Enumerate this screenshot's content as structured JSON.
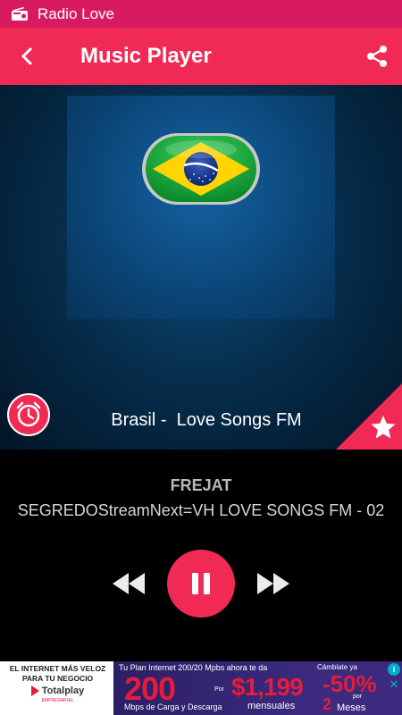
{
  "status_bar": {
    "app_name": "Radio Love",
    "icon": "radio-icon"
  },
  "toolbar": {
    "title": "Music Player",
    "back_icon": "chevron-left-icon",
    "share_icon": "share-icon"
  },
  "player": {
    "station_name": "Brasil -  Love Songs FM",
    "artist": "FREJAT",
    "track": "SEGREDOStreamNext=VH LOVE SONGS FM - 02",
    "alarm_icon": "alarm-clock-icon",
    "favorite_icon": "star-icon",
    "artwork": "brazil-flag"
  },
  "controls": {
    "rewind_icon": "rewind-icon",
    "pause_icon": "pause-icon",
    "forward_icon": "fast-forward-icon"
  },
  "ad": {
    "left_line1": "EL INTERNET MÁS VELOZ",
    "left_line2": "PARA TU NEGOCIO",
    "brand": "Totalplay",
    "brand_sub": "EMPRESARIAL",
    "mid_top": "Tu Plan Internet 200/20 Mpbs ahora te da",
    "mid_big": "200",
    "mid_por": "Por",
    "mid_price": "$1,199",
    "mid_bottom": "Mbps de Carga y Descarga",
    "mid_mensuales": "mensuales",
    "right_top": "Cámbiate ya",
    "right_pct": "-50%",
    "right_por": "por",
    "right_num": "2",
    "right_meses": "Meses",
    "adchoices_label": "i",
    "close_label": "✕"
  },
  "colors": {
    "accent": "#f02a55",
    "status_bar": "#d81b60"
  }
}
